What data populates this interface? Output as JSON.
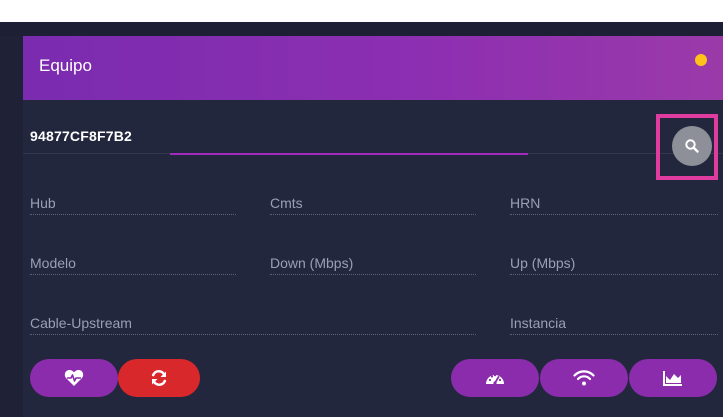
{
  "header": {
    "title": "Equipo",
    "status_color": "#ffc21a"
  },
  "device": {
    "id_value": "94877CF8F7B2"
  },
  "search": {
    "icon": "search-icon"
  },
  "fields": {
    "hub": "Hub",
    "cmts": "Cmts",
    "hrn": "HRN",
    "modelo": "Modelo",
    "down": "Down (Mbps)",
    "up": "Up (Mbps)",
    "cable_upstream": "Cable-Upstream",
    "instancia": "Instancia"
  },
  "actions": [
    {
      "name": "health-button",
      "icon": "heart-pulse-icon",
      "color": "#8a2cab"
    },
    {
      "name": "refresh-button",
      "icon": "sync-icon",
      "color": "#d8282b"
    },
    {
      "name": "speedometer-button",
      "icon": "speedometer-icon",
      "color": "#8a2cab"
    },
    {
      "name": "wifi-button",
      "icon": "wifi-icon",
      "color": "#8a2cab"
    },
    {
      "name": "area-chart-button",
      "icon": "area-chart-icon",
      "color": "#8a2cab"
    }
  ]
}
